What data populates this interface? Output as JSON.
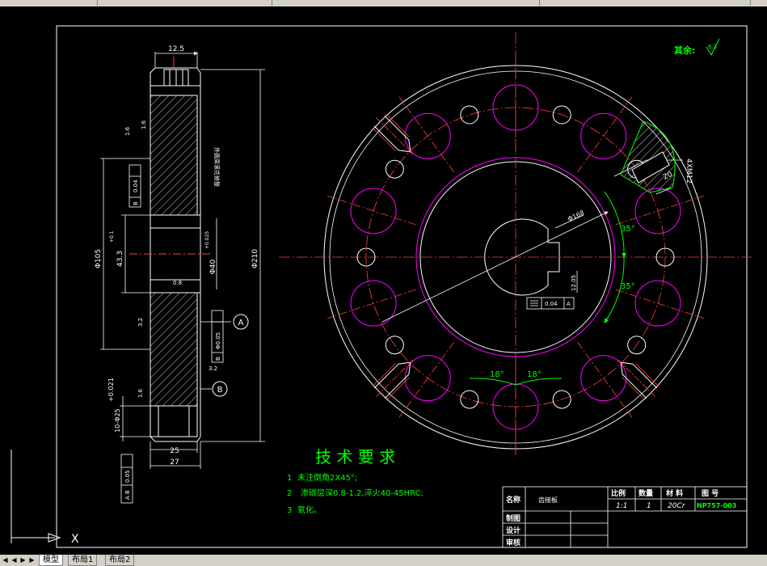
{
  "surface_finish": {
    "label": "其余:",
    "value": "6.3"
  },
  "tech": {
    "title": "技 术 要 求",
    "items": [
      {
        "num": "1",
        "text": "未注倒角2X45°;"
      },
      {
        "num": "2",
        "text": "渗碳层深0.8-1.2,淬火40-45HRC;"
      },
      {
        "num": "3",
        "text": "氧化。"
      }
    ]
  },
  "title_block": {
    "name_label": "名称",
    "name": "齿接板",
    "scale_label": "比例",
    "scale": "1:1",
    "qty_label": "数量",
    "qty": "1",
    "material_label": "材 料",
    "material": "20Cr",
    "drawing_no_label": "图 号",
    "drawing_no": "NP757-003",
    "drawn_label": "制图",
    "design_label": "设计",
    "review_label": "审核"
  },
  "dims": {
    "top_width": "12.5",
    "d105": "Φ105",
    "d43": "43.3",
    "d43_tol": "+0.1",
    "d40": "Φ40",
    "d40_tol": "+0.025",
    "d210": "Φ210",
    "w25": "25",
    "w27": "27",
    "hole_spec": "10-Φ25",
    "hole_tol": "+0.021",
    "thread_spec": "4XM12",
    "d20": "20",
    "d168": "Φ168",
    "ang1": "35°",
    "ang2": "35°",
    "ang3": "18°",
    "ang4": "18°",
    "key": "12.05",
    "rough1": "0.8",
    "rough2": "3.2",
    "rough3": "1.6",
    "rough4": "1.6",
    "rough5": "3.2",
    "rough6": "1.6",
    "note_vertical": "外圆周滚花修整",
    "ref_a": "A",
    "ref_b": "B"
  },
  "fcf": {
    "parallel": {
      "tol": "0.04",
      "ref": "B"
    },
    "runout": {
      "tol": "Φ0.05",
      "ref": "B"
    },
    "position": {
      "tol": "0.05",
      "ref": "A B"
    },
    "symmetry": {
      "tol": "0.04",
      "ref": "A"
    }
  },
  "ucs": {
    "x_label": "X"
  },
  "tabs": {
    "model": "模型",
    "layout1": "布局1",
    "layout2": "布局2"
  }
}
